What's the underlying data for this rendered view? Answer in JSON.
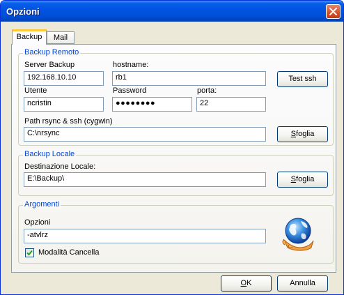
{
  "window": {
    "title": "Opzioni"
  },
  "tabs": [
    {
      "label": "Backup"
    },
    {
      "label": "Mail"
    }
  ],
  "remote": {
    "group_title": "Backup Remoto",
    "server_label": "Server Backup",
    "server_value": "192.168.10.10",
    "hostname_label": "hostname:",
    "hostname_value": "rb1",
    "test_button": "Test ssh",
    "user_label": "Utente",
    "user_value": "ncristin",
    "password_label": "Password",
    "password_value": "●●●●●●●●",
    "port_label": "porta:",
    "port_value": "22",
    "path_label": "Path rsync & ssh (cygwin)",
    "path_value": "C:\\nrsync",
    "browse_button_rest": "foglia",
    "browse_button_mnemonic": "S"
  },
  "local": {
    "group_title": "Backup Locale",
    "dest_label": "Destinazione Locale:",
    "dest_value": "E:\\Backup\\",
    "browse_button_rest": "foglia",
    "browse_button_mnemonic": "S"
  },
  "args": {
    "group_title": "Argomenti",
    "options_label": "Opzioni",
    "options_value": "-atvlrz",
    "delete_mode_label": "Modalità Cancella",
    "delete_mode_checked": true,
    "icon": "globe-hand-icon"
  },
  "footer": {
    "ok_mnemonic": "O",
    "ok_rest": "K",
    "cancel_label": "Annulla"
  }
}
